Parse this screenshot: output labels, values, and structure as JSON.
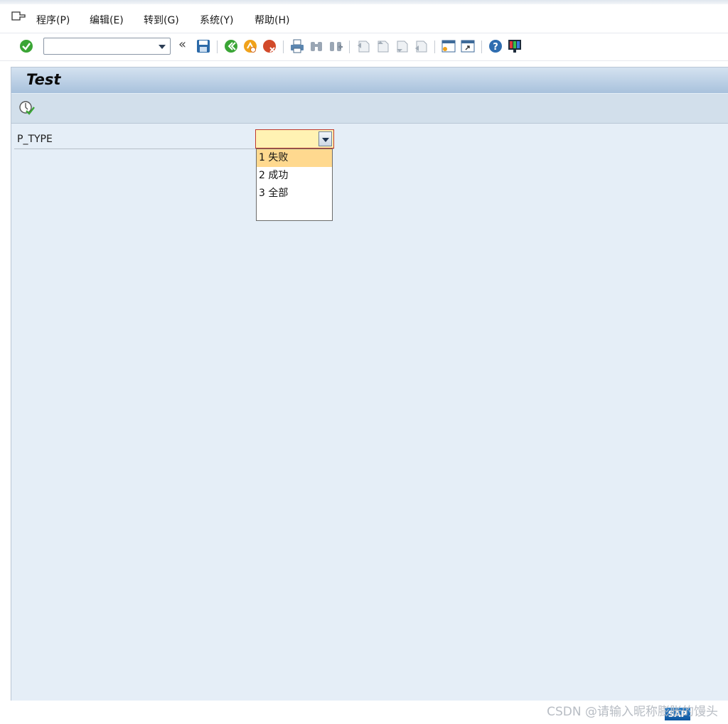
{
  "menu": {
    "items": [
      "程序(P)",
      "编辑(E)",
      "转到(G)",
      "系统(Y)",
      "帮助(H)"
    ]
  },
  "toolbar": {
    "command_value": "",
    "back_double": "«"
  },
  "screen": {
    "title": "Test"
  },
  "selection": {
    "field_label": "P_TYPE",
    "field_value": "",
    "dropdown_options": [
      "1 失败",
      "2 成功",
      "3 全部"
    ],
    "highlighted_option_index": 0
  },
  "footer": {
    "watermark": "CSDN @请输入昵称膨胀的馒头",
    "logo_text": "SAP"
  },
  "colors": {
    "frame_bg": "#e5eef7",
    "field_required_bg": "#fff2b3",
    "dropdown_highlight": "#ffd98f",
    "ok_green": "#3aa535",
    "cancel_red": "#d24a2a",
    "exit_orange": "#f0a21b"
  }
}
